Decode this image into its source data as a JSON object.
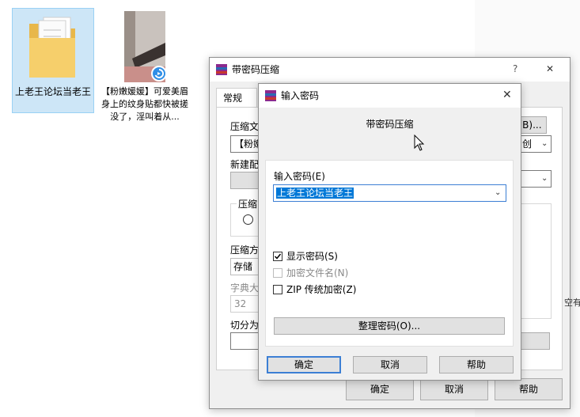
{
  "desktop": {
    "folder_label": "上老王论坛当老王",
    "video_label": "【粉嫩媛媛】可爱美眉身上的纹身贴都快被搓没了，淫叫着从..."
  },
  "back_dialog": {
    "title": "带密码压缩",
    "help_glyph": "?",
    "close_glyph": "✕",
    "tab_general": "常规",
    "archive_name_label_partial": "压缩文",
    "archive_name_value_partial": "【粉嫩",
    "browse_button": "(B)...",
    "update_mode_partial": "创",
    "new_config_partial": "新建配",
    "compress_group_partial": "压缩",
    "method_label_partial": "压缩方",
    "method_value": "存储",
    "dict_label_partial": "字典大",
    "dict_value": "32",
    "split_label_partial": "切分为",
    "side_text_partial": "空有",
    "ok_button": "确定",
    "cancel_button": "取消",
    "help_button": "帮助"
  },
  "front_dialog": {
    "title": "输入密码",
    "close_glyph": "✕",
    "heading": "带密码压缩",
    "password_label": "输入密码(E)",
    "password_value": "上老王论坛当老王",
    "show_password": {
      "label": "显示密码(S)",
      "checked": true
    },
    "encrypt_filenames": {
      "label": "加密文件名(N)",
      "checked": false,
      "disabled": true
    },
    "zip_legacy": {
      "label": "ZIP 传统加密(Z)",
      "checked": false
    },
    "organize_button": "整理密码(O)...",
    "ok_button": "确定",
    "cancel_button": "取消",
    "help_button": "帮助"
  },
  "colors": {
    "selection": "#cde6f7",
    "text_selection": "#0078d7",
    "dialog_bg": "#f0f0f0",
    "default_button_border": "#3c7fd4"
  }
}
